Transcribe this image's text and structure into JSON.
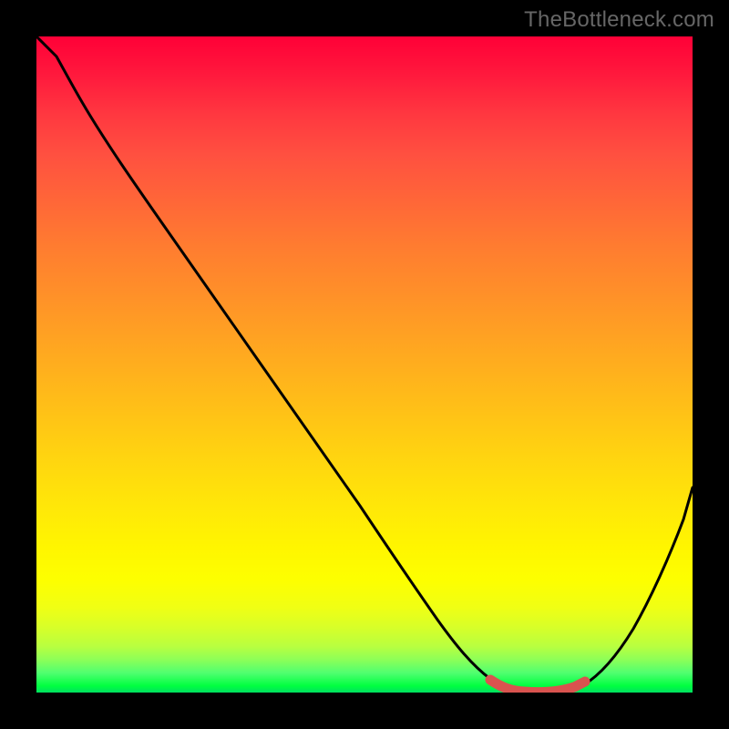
{
  "watermark": "TheBottleneck.com",
  "chart_data": {
    "type": "line",
    "title": "",
    "xlabel": "",
    "ylabel": "",
    "xlim": [
      0,
      100
    ],
    "ylim": [
      0,
      100
    ],
    "legend": false,
    "grid": false,
    "background": "vertical rainbow gradient (red top → yellow middle → green bottom) inside black frame",
    "series": [
      {
        "name": "curve",
        "color": "#000000",
        "x": [
          0,
          3,
          6,
          10,
          15,
          20,
          25,
          30,
          35,
          40,
          45,
          50,
          55,
          58,
          62,
          66,
          70,
          74,
          78,
          82,
          86,
          90,
          94,
          98,
          100
        ],
        "y": [
          100,
          97,
          93,
          88,
          81,
          74,
          67,
          60,
          53,
          46,
          39,
          32,
          25,
          20,
          14,
          8,
          4,
          1,
          0,
          0,
          3,
          10,
          20,
          31,
          37
        ]
      },
      {
        "name": "highlighted-segment",
        "color": "#d9534f",
        "x_range": [
          72,
          85
        ],
        "y_approx": [
          1.5,
          0.5,
          0,
          0,
          0,
          0.5,
          1.5
        ],
        "note": "thick red rounded segment at curve minimum"
      }
    ]
  }
}
